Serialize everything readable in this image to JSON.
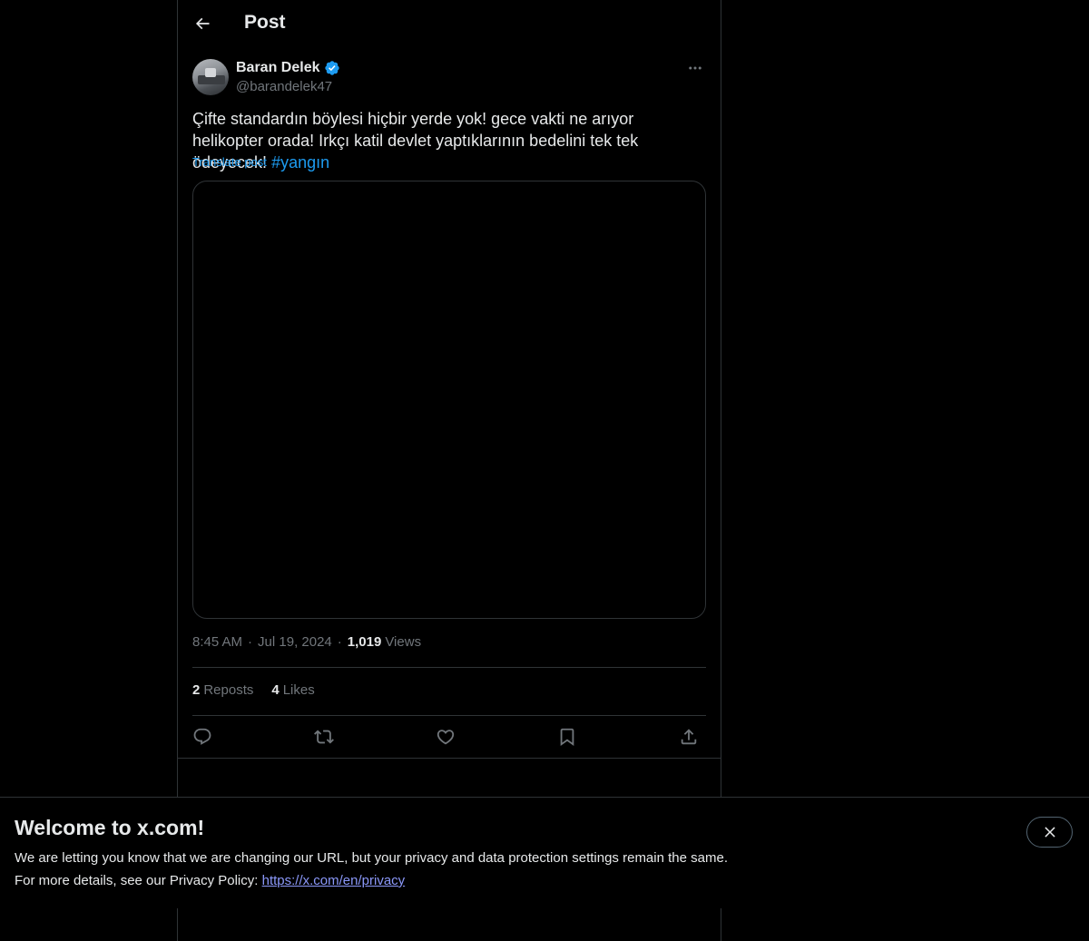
{
  "header": {
    "title": "Post",
    "back_icon": "arrow-left-icon"
  },
  "post": {
    "author": {
      "name": "Baran Delek",
      "handle": "@barandelek47",
      "verified": true,
      "verified_color": "#1d9bf0"
    },
    "text": "Çifte standardın böylesi hiçbir yerde yok! gece vakti ne arıyor helikopter orada! Irkçı katil devlet yaptıklarının bedelini tek tek ödeyecek!",
    "hashtag": "#yangın",
    "translate_label": "Translate post",
    "time": "8:45 AM",
    "date": "Jul 19, 2024",
    "views_count": "1,019",
    "views_label": "Views",
    "reposts_count": "2",
    "reposts_label": "Reposts",
    "likes_count": "4",
    "likes_label": "Likes"
  },
  "actions": [
    "reply-icon",
    "repost-icon",
    "like-icon",
    "bookmark-icon",
    "share-icon"
  ],
  "banner": {
    "title": "Welcome to x.com!",
    "line1": "We are letting you know that we are changing our URL, but your privacy and data protection settings remain the same.",
    "line2_prefix": "For more details, see our Privacy Policy:",
    "link": "https://x.com/en/privacy",
    "close_icon": "close-icon"
  },
  "colors": {
    "background": "#000000",
    "text": "#e7e9ea",
    "muted": "#71767b",
    "accent": "#1d9bf0",
    "border": "#2f3336",
    "link": "#8b98f9"
  }
}
